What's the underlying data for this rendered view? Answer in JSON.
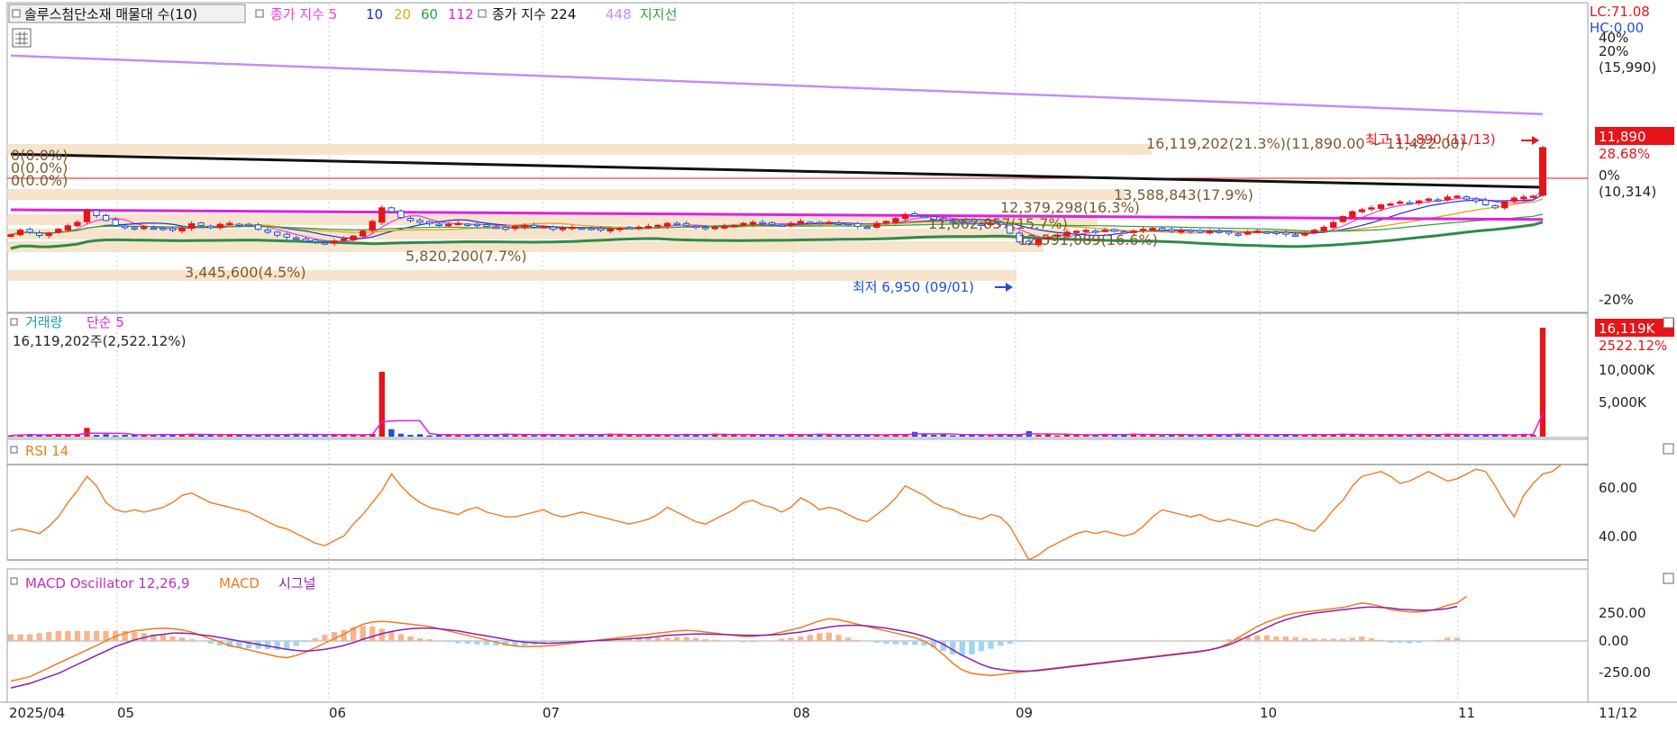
{
  "price_legend": {
    "stock": "솔루스첨단소재 매물대 수(10)",
    "ma_title": "종가 지수 5",
    "ma10": "10",
    "ma20": "20",
    "ma60": "60",
    "ma112": "112",
    "ma224_title": "종가 지수 224",
    "ma448": "448",
    "support": "지지선"
  },
  "colors": {
    "up": "#e8141a",
    "down": "#1e4fd8",
    "ma5": "#e83fe0",
    "ma10": "#1b2fd6",
    "ma20": "#e6a81e",
    "ma60": "#2ea23a",
    "ma112": "#e020e0",
    "ma224": "#111111",
    "ma448": "#c48ef2",
    "support": "#2c8c4a",
    "zone": "#f6e1c6",
    "rsi": "#f07a20",
    "macd": "#f07a20",
    "signal": "#8b1fb0",
    "osc_pos": "#f7b58e",
    "osc_neg": "#9dd6f0"
  },
  "right_top": {
    "lc": "LC:71.08",
    "hc": "HC:0.00",
    "pct_high": "40%",
    "pct_20": "20%",
    "p15990": "(15,990)",
    "price_tag": "11,890",
    "pct_tag": "28.68%",
    "pct_0": "0%",
    "p10314": "(10,314)",
    "pct_neg20": "-20%"
  },
  "price_annotations": {
    "high_label": "최고 11,890 (11/13)",
    "low_label": "최저 6,950 (09/01)",
    "zones": [
      "0(0.0%)",
      "0(0.0%)",
      "0(0.0%)",
      "16,119,202(21.3%)(11,890.00 ~ 11,422.00)",
      "13,588,843(17.9%)",
      "12,379,298(16.3%)",
      "11,862,857(15.7%)",
      "12,591,089(16.6%)",
      "5,820,200(7.7%)",
      "3,445,600(4.5%)"
    ]
  },
  "volume": {
    "title": "거래량",
    "ma_label": "단순 5",
    "value_text": "16,119,202주(2,522.12%)",
    "tag": "16,119K",
    "tag_pct": "2522.12%",
    "ticks": [
      "10,000K",
      "5,000K"
    ]
  },
  "rsi": {
    "title": "RSI 14",
    "ticks": [
      "60.00",
      "40.00"
    ]
  },
  "macd": {
    "title": "MACD Oscillator 12,26,9",
    "macd_label": "MACD",
    "signal_label": "시그널",
    "ticks": [
      "250.00",
      "0.00",
      "-250.00"
    ]
  },
  "x_axis": {
    "labels": [
      "2025/04",
      "05",
      "06",
      "07",
      "08",
      "09",
      "10",
      "11",
      "11/12"
    ]
  },
  "chart_data": {
    "type": "candlestick",
    "period": "2025/04 - 2025/11",
    "price": {
      "high": 11890,
      "high_date": "11/13",
      "low": 6950,
      "low_date": "09/01",
      "last": 11890,
      "reference": 10314,
      "scale_labels": [
        "40%",
        "20%",
        "0%",
        "-20%"
      ],
      "closes": [
        7420,
        7650,
        7550,
        7380,
        7500,
        7700,
        7880,
        8050,
        8700,
        8400,
        8150,
        7900,
        7780,
        7750,
        7800,
        7750,
        7700,
        7650,
        7750,
        7980,
        7900,
        7780,
        7950,
        8000,
        7950,
        7880,
        7700,
        7550,
        7400,
        7300,
        7200,
        7100,
        7050,
        7000,
        7100,
        7200,
        7350,
        7600,
        8100,
        8800,
        8600,
        8300,
        8150,
        8050,
        8000,
        7900,
        7950,
        8000,
        7950,
        7900,
        7850,
        7800,
        7700,
        7850,
        7900,
        7800,
        7850,
        7700,
        7750,
        7800,
        7750,
        7700,
        7650,
        7700,
        7750,
        7780,
        7800,
        7850,
        7900,
        8000,
        7950,
        7900,
        7800,
        7750,
        7800,
        7850,
        7900,
        8000,
        8050,
        8000,
        7950,
        7900,
        8000,
        8100,
        8050,
        8000,
        8050,
        8000,
        7950,
        7850,
        7800,
        8000,
        8100,
        8250,
        8450,
        8400,
        8350,
        8200,
        8150,
        8100,
        8050,
        8000,
        7950,
        8000,
        7950,
        7500,
        7050,
        6950,
        7200,
        7300,
        7400,
        7550,
        7600,
        7650,
        7600,
        7650,
        7600,
        7550,
        7600,
        7700,
        7750,
        7650,
        7600,
        7650,
        7600,
        7550,
        7600,
        7550,
        7500,
        7450,
        7550,
        7600,
        7550,
        7500,
        7450,
        7400,
        7500,
        7650,
        7800,
        8050,
        8350,
        8600,
        8700,
        8800,
        8950,
        9000,
        9100,
        9050,
        9150,
        9250,
        9200,
        9350,
        9400,
        9250,
        9150,
        8950,
        8800,
        9100,
        9300,
        9350,
        9400,
        11890
      ],
      "ma_series": [
        "5",
        "10",
        "20",
        "60",
        "112",
        "224",
        "448"
      ]
    },
    "volume": {
      "last": 16119202,
      "last_pct": 2522.12,
      "ma": "단순 5",
      "spikes": [
        {
          "date": "06",
          "value": 9600000
        },
        {
          "date": "11/13",
          "value": 16119202
        }
      ],
      "ticks": [
        10000000,
        5000000
      ]
    },
    "rsi": {
      "period": 14,
      "last": 71.08,
      "ticks": [
        60,
        40
      ],
      "values": [
        43,
        44,
        43,
        42,
        45,
        49,
        55,
        60,
        66,
        62,
        55,
        52,
        51,
        52,
        51,
        52,
        53,
        55,
        58,
        59,
        57,
        55,
        54,
        53,
        52,
        51,
        49,
        47,
        45,
        44,
        42,
        40,
        38,
        37,
        39,
        41,
        46,
        50,
        55,
        60,
        67,
        62,
        58,
        55,
        53,
        52,
        51,
        50,
        52,
        53,
        51,
        50,
        49,
        49,
        50,
        51,
        52,
        50,
        49,
        50,
        51,
        50,
        49,
        48,
        47,
        46,
        47,
        48,
        50,
        53,
        51,
        49,
        47,
        46,
        48,
        50,
        52,
        55,
        56,
        54,
        53,
        51,
        53,
        57,
        55,
        52,
        53,
        52,
        50,
        48,
        47,
        50,
        53,
        57,
        62,
        60,
        58,
        55,
        53,
        52,
        50,
        49,
        48,
        50,
        49,
        45,
        38,
        31,
        33,
        36,
        38,
        40,
        42,
        43,
        42,
        43,
        42,
        41,
        42,
        45,
        49,
        52,
        51,
        50,
        49,
        50,
        48,
        47,
        48,
        47,
        46,
        45,
        47,
        48,
        47,
        46,
        44,
        43,
        47,
        52,
        56,
        62,
        66,
        67,
        68,
        66,
        63,
        64,
        66,
        68,
        66,
        64,
        65,
        67,
        69,
        68,
        62,
        55,
        49,
        58,
        63,
        67,
        68,
        71.08
      ]
    },
    "macd": {
      "params": "12,26,9",
      "ticks": [
        250,
        0,
        -250
      ],
      "macd": [
        -360,
        -340,
        -320,
        -280,
        -240,
        -200,
        -160,
        -120,
        -80,
        -40,
        0,
        40,
        70,
        90,
        100,
        110,
        115,
        110,
        100,
        80,
        50,
        20,
        -10,
        -40,
        -60,
        -80,
        -100,
        -120,
        -140,
        -150,
        -130,
        -100,
        -60,
        -20,
        20,
        60,
        110,
        150,
        170,
        175,
        170,
        160,
        150,
        140,
        130,
        110,
        90,
        70,
        50,
        30,
        10,
        -10,
        -30,
        -45,
        -50,
        -50,
        -45,
        -40,
        -30,
        -20,
        -10,
        0,
        10,
        20,
        30,
        40,
        50,
        60,
        70,
        80,
        90,
        95,
        90,
        80,
        70,
        60,
        50,
        40,
        40,
        50,
        60,
        80,
        100,
        120,
        150,
        180,
        200,
        190,
        170,
        150,
        130,
        110,
        90,
        70,
        50,
        30,
        0,
        -50,
        -120,
        -200,
        -260,
        -290,
        -300,
        -310,
        -300,
        -290,
        -280,
        -270,
        -260,
        -250,
        -240,
        -230,
        -220,
        -210,
        -200,
        -190,
        -180,
        -170,
        -160,
        -150,
        -140,
        -130,
        -120,
        -110,
        -100,
        -90,
        -80,
        -60,
        -20,
        30,
        80,
        130,
        170,
        200,
        230,
        250,
        260,
        270,
        280,
        290,
        300,
        320,
        340,
        330,
        310,
        280,
        270,
        260,
        260,
        270,
        290,
        320,
        340,
        400
      ],
      "signal": [
        -420,
        -400,
        -380,
        -350,
        -320,
        -290,
        -250,
        -210,
        -170,
        -130,
        -90,
        -50,
        -20,
        10,
        30,
        50,
        60,
        70,
        70,
        65,
        55,
        45,
        30,
        15,
        0,
        -15,
        -30,
        -45,
        -60,
        -75,
        -85,
        -90,
        -85,
        -75,
        -60,
        -40,
        -15,
        15,
        40,
        65,
        85,
        100,
        110,
        115,
        115,
        110,
        100,
        90,
        75,
        60,
        45,
        30,
        15,
        0,
        -10,
        -15,
        -20,
        -20,
        -15,
        -10,
        -5,
        0,
        5,
        10,
        15,
        20,
        25,
        30,
        40,
        50,
        55,
        60,
        62,
        62,
        60,
        58,
        55,
        52,
        50,
        52,
        55,
        60,
        70,
        80,
        95,
        110,
        125,
        135,
        140,
        140,
        135,
        125,
        115,
        100,
        85,
        65,
        40,
        10,
        -30,
        -80,
        -130,
        -170,
        -210,
        -240,
        -255,
        -265,
        -270,
        -270,
        -265,
        -255,
        -245,
        -235,
        -225,
        -215,
        -205,
        -195,
        -185,
        -175,
        -165,
        -155,
        -145,
        -135,
        -125,
        -115,
        -105,
        -95,
        -80,
        -60,
        -35,
        0,
        40,
        80,
        120,
        160,
        190,
        215,
        235,
        250,
        260,
        270,
        280,
        290,
        300,
        305,
        300,
        295,
        285,
        280,
        275,
        275,
        280,
        290,
        310
      ]
    }
  }
}
